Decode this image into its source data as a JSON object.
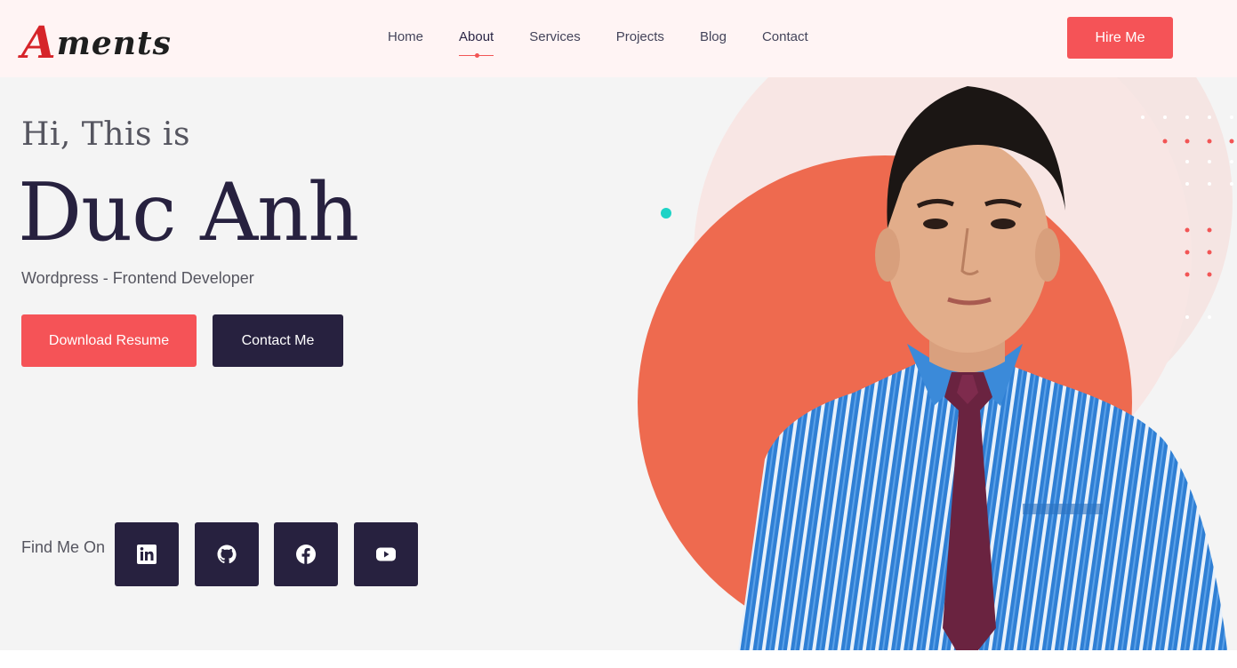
{
  "logo": {
    "first_letter": "A",
    "rest": "ments"
  },
  "nav": {
    "items": [
      {
        "label": "Home"
      },
      {
        "label": "About"
      },
      {
        "label": "Services"
      },
      {
        "label": "Projects"
      },
      {
        "label": "Blog"
      },
      {
        "label": "Contact"
      }
    ],
    "active": "About"
  },
  "header": {
    "hire_label": "Hire Me"
  },
  "hero": {
    "greeting": "Hi, This is",
    "name": "Duc Anh",
    "role": "Wordpress - Frontend Developer",
    "download_label": "Download Resume",
    "contact_label": "Contact Me",
    "find_label": "Find Me On"
  },
  "social": [
    {
      "icon": "linkedin-icon"
    },
    {
      "icon": "github-icon"
    },
    {
      "icon": "facebook-icon"
    },
    {
      "icon": "youtube-icon"
    }
  ],
  "colors": {
    "accent": "#f55357",
    "dark": "#27213f",
    "orange_circle": "#ee6a4f",
    "teal_dot": "#1ed3c6",
    "header_bg": "#fff4f4",
    "hero_bg": "#f4f4f4"
  }
}
